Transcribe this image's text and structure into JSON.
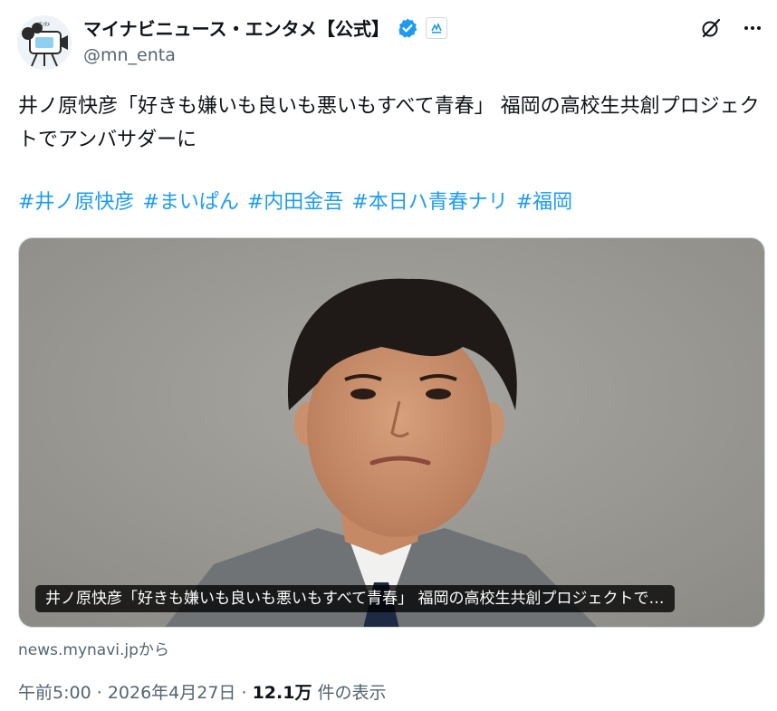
{
  "author": {
    "display_name": "マイナビニュース・エンタメ【公式】",
    "handle": "@mn_enta",
    "avatar_icon": "camera-mascot-icon",
    "verified_color": "#1d9bf0"
  },
  "top_icons": [
    "grok-icon",
    "more-icon"
  ],
  "tweet": {
    "text": "井ノ原快彦「好きも嫌いも良いも悪いもすべて青春」 福岡の高校生共創プロジェクトでアンバサダーに",
    "hashtags": [
      "#井ノ原快彦",
      "#まいぱん",
      "#内田金吾",
      "#本日ハ青春ナリ",
      "#福岡"
    ],
    "hashtag_color": "#1d9bf0"
  },
  "media": {
    "caption": "井ノ原快彦「好きも嫌いも良いも悪いもすべて青春」 福岡の高校生共創プロジェクトで…",
    "source": "news.mynavi.jpから",
    "image_icon": "portrait-photo"
  },
  "meta": {
    "time": "午前5:00",
    "sep1": "·",
    "date": "2026年4月27日",
    "sep2": "·",
    "views_count": "12.1万",
    "views_label": "件の表示"
  }
}
